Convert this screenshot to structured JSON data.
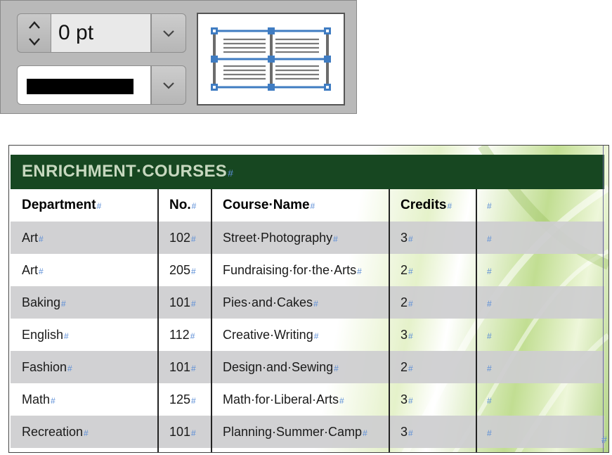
{
  "stroke_panel": {
    "weight_value": "0 pt",
    "stroke_color": "#000000",
    "icons": {
      "stepper": "up-down-stepper-icon",
      "dropdown": "chevron-down-icon",
      "proxy": "table-cell-proxy-icon"
    }
  },
  "table": {
    "title": "ENRICHMENT·COURSES",
    "end_mark": "#",
    "cell_mark": "#",
    "header_color": "#174721",
    "shaded_row_color": "#cecece",
    "columns": [
      "Department",
      "No.",
      "Course·Name",
      "Credits",
      ""
    ],
    "rows": [
      [
        "Art",
        "102",
        "Street·Photography",
        "3",
        ""
      ],
      [
        "Art",
        "205",
        "Fundraising·for·the·Arts",
        "2",
        ""
      ],
      [
        "Baking",
        "101",
        "Pies·and·Cakes",
        "2",
        ""
      ],
      [
        "English",
        "112",
        "Creative·Writing",
        "3",
        ""
      ],
      [
        "Fashion",
        "101",
        "Design·and·Sewing",
        "2",
        ""
      ],
      [
        "Math",
        "125",
        "Math·for·Liberal·Arts",
        "3",
        ""
      ],
      [
        "Recreation",
        "101",
        "Planning·Summer·Camp",
        "3",
        ""
      ]
    ]
  }
}
